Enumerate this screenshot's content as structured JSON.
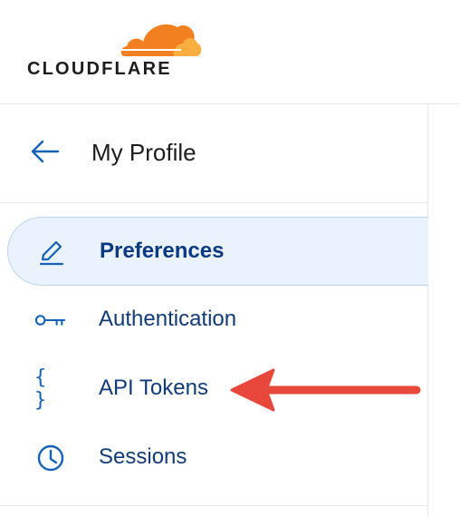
{
  "brand": {
    "name": "CLOUDFLARE",
    "logo_colors": {
      "cloud_dark": "#f38020",
      "cloud_light": "#faae40",
      "text": "#1d1d1d"
    }
  },
  "profile": {
    "title": "My Profile",
    "back_icon": "arrow-left-icon"
  },
  "nav": {
    "items": [
      {
        "label": "Preferences",
        "icon": "pencil-icon",
        "active": true
      },
      {
        "label": "Authentication",
        "icon": "key-icon",
        "active": false
      },
      {
        "label": "API Tokens",
        "icon": "braces-icon",
        "icon_text": "{ }",
        "active": false
      },
      {
        "label": "Sessions",
        "icon": "clock-icon",
        "active": false
      }
    ]
  },
  "colors": {
    "accent": "#1561b8",
    "active_bg": "#eaf3fd",
    "active_text": "#0a3a82",
    "annotation_arrow": "#e8473b"
  }
}
